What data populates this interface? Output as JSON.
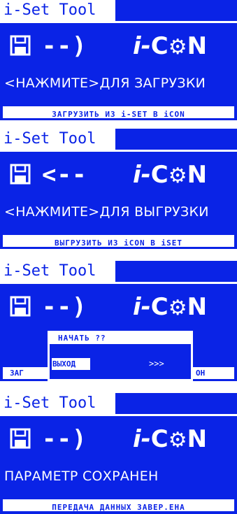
{
  "colors": {
    "screen_bg": "#0a23e6",
    "text": "#ffffff"
  },
  "icons": {
    "disk": "floppy-disk-icon",
    "brand_gear": "gear-icon"
  },
  "screens": [
    {
      "title": "i-Set Tool",
      "arrow": "--)",
      "brand_i": "i",
      "brand_dash": "-",
      "brand_c": "C",
      "brand_gear": "⚙",
      "brand_n": "N",
      "prompt": "<НАЖМИТЕ>ДЛЯ ЗАГРУЗКИ",
      "status": "ЗАГРУЗИТЬ ИЗ i-SET В iCON"
    },
    {
      "title": "i-Set Tool",
      "arrow": "<--",
      "brand_i": "i",
      "brand_dash": "-",
      "brand_c": "C",
      "brand_gear": "⚙",
      "brand_n": "N",
      "prompt": "<НАЖМИТЕ>ДЛЯ ВЫГРУЗКИ",
      "status": "ВЫГРУЗИТЬ ИЗ iCON В iSET"
    },
    {
      "title": "i-Set Tool",
      "arrow": "--)",
      "brand_i": "i",
      "brand_dash": "-",
      "brand_c": "C",
      "brand_gear": "⚙",
      "brand_n": "N",
      "status_left": "ЗАГ",
      "status_right": "ОН",
      "dialog": {
        "title": "НАЧАТЬ ??",
        "option": "ВЫХОД",
        "more": ">>>"
      }
    },
    {
      "title": "i-Set Tool",
      "arrow": "--)",
      "brand_i": "i",
      "brand_dash": "-",
      "brand_c": "C",
      "brand_gear": "⚙",
      "brand_n": "N",
      "prompt": "ПАРАМЕТР СОХРАНЕН",
      "status": "ПЕРЕДАЧА ДАННЫХ ЗАВЕР.ЕНА"
    }
  ]
}
